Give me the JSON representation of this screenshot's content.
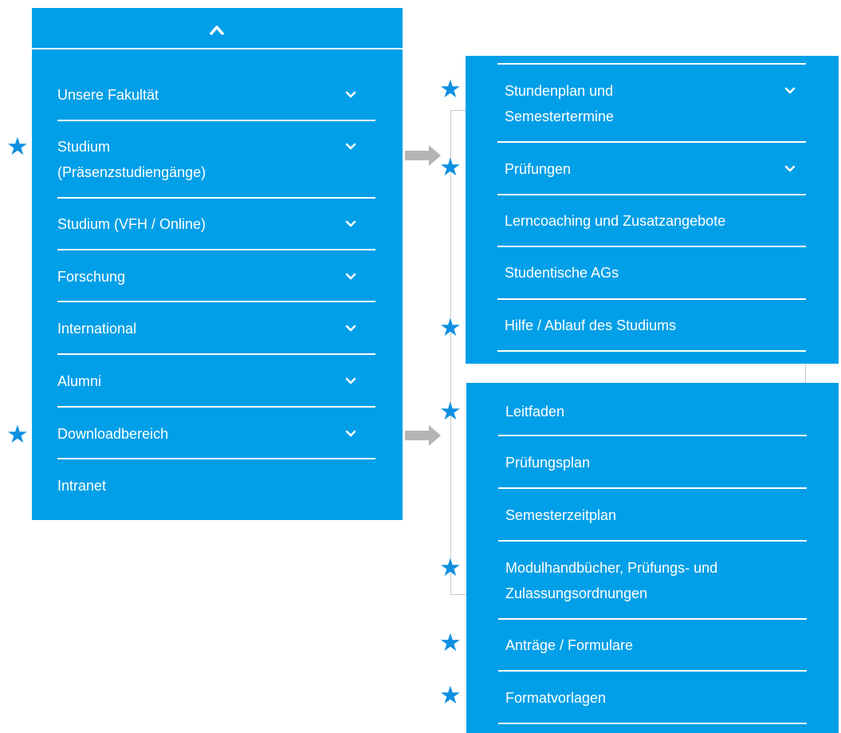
{
  "main_menu": {
    "collapse_icon": "chevron-up-icon",
    "items": [
      {
        "label": "Unsere Fakultät",
        "expandable": true
      },
      {
        "label": "Studium\n(Präsenzstudiengänge)",
        "expandable": true,
        "starred": true
      },
      {
        "label": "Studium (VFH / Online)",
        "expandable": true
      },
      {
        "label": "Forschung",
        "expandable": true
      },
      {
        "label": "International",
        "expandable": true
      },
      {
        "label": "Alumni",
        "expandable": true
      },
      {
        "label": "Downloadbereich",
        "expandable": true,
        "starred": true
      },
      {
        "label": "Intranet",
        "expandable": false
      }
    ]
  },
  "studium_submenu": {
    "items": [
      {
        "label": "Stundenplan und\nSemestertermine",
        "expandable": true,
        "starred": true
      },
      {
        "label": "Prüfungen",
        "expandable": true,
        "starred": true
      },
      {
        "label": "Lerncoaching und Zusatzangebote",
        "expandable": false
      },
      {
        "label": "Studentische AGs",
        "expandable": false
      },
      {
        "label": "Hilfe / Ablauf des Studiums",
        "expandable": false,
        "starred": true
      }
    ]
  },
  "download_submenu": {
    "items": [
      {
        "label": "Leitfaden",
        "starred": true
      },
      {
        "label": "Prüfungsplan"
      },
      {
        "label": "Semesterzeitplan"
      },
      {
        "label": "Modulhandbücher, Prüfungs- und\nZulassungsordnungen",
        "starred": true
      },
      {
        "label": "Anträge / Formulare",
        "starred": true
      },
      {
        "label": "Formatvorlagen",
        "starred": true
      }
    ]
  },
  "annotations": {
    "star_symbol": "★",
    "star_icon": "star-icon",
    "arrow_icon": "arrow-right-icon",
    "star_color": "#0e8fe0",
    "arrow_color": "#b4b4b4"
  },
  "colors": {
    "menu_background": "#009fe8",
    "menu_text": "#ffffff",
    "separator": "#ffffff"
  }
}
